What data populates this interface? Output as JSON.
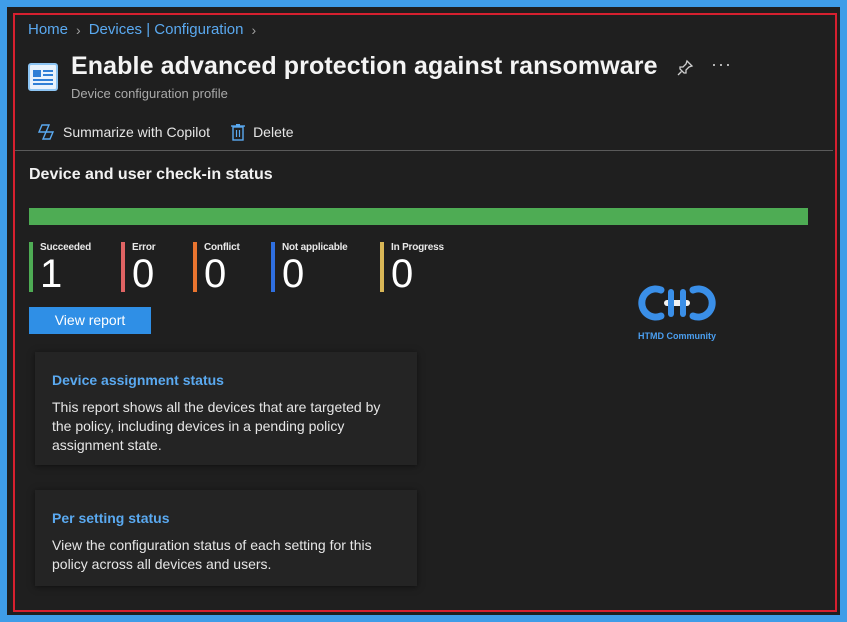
{
  "breadcrumb": {
    "items": [
      "Home",
      "Devices | Configuration"
    ]
  },
  "header": {
    "title": "Enable advanced protection against ransomware",
    "subtitle": "Device configuration profile",
    "icon": "profile-document-icon"
  },
  "toolbar": {
    "copilot_label": "Summarize with Copilot",
    "delete_label": "Delete"
  },
  "status": {
    "section_title": "Device and user check-in status",
    "progress_fraction": 1.0,
    "stats": [
      {
        "label": "Succeeded",
        "value": "1",
        "color": "#4eac54"
      },
      {
        "label": "Error",
        "value": "0",
        "color": "#e06464"
      },
      {
        "label": "Conflict",
        "value": "0",
        "color": "#e9742f"
      },
      {
        "label": "Not applicable",
        "value": "0",
        "color": "#2f6fe0"
      },
      {
        "label": "In Progress",
        "value": "0",
        "color": "#d8b656"
      }
    ],
    "view_report_label": "View report"
  },
  "cards": [
    {
      "title": "Device assignment status",
      "description": "This report shows all the devices that are targeted by the policy, including devices in a pending policy assignment state."
    },
    {
      "title": "Per setting status",
      "description": "View the configuration status of each setting for this policy across all devices and users."
    }
  ],
  "watermark": {
    "text": "HTMD Community"
  },
  "colors": {
    "accent": "#2f8fe6",
    "link": "#5aa9f0",
    "highlight_border": "#d6202f",
    "outer": "#3f9de8"
  }
}
